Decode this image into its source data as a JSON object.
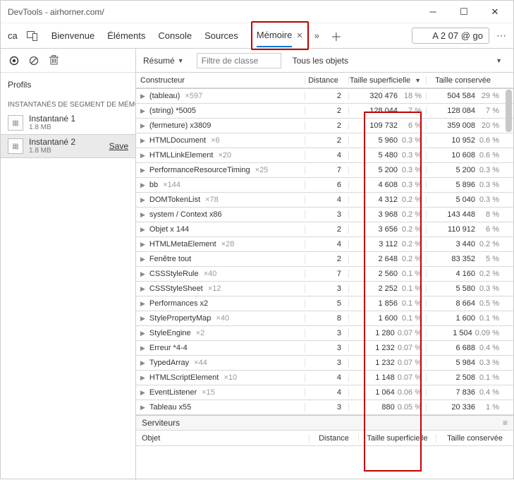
{
  "window": {
    "title": "DevTools - airhorner.com/"
  },
  "topstrip": {
    "prefix": "ca",
    "tabs": {
      "welcome": "Bienvenue",
      "elements": "Éléments",
      "console": "Console",
      "sources": "Sources",
      "memory": "Mémoire"
    },
    "url_box": "A 2 07 @ go"
  },
  "sidebar": {
    "profils": "Profils",
    "section": "INSTANTANÉS DE SEGMENT DE MÉMOIRE",
    "snapshots": [
      {
        "name": "Instantané 1",
        "size": "1.8 MB"
      },
      {
        "name": "Instantané 2",
        "size": "1.8 MB",
        "save": "Save"
      }
    ]
  },
  "filterbar": {
    "summary": "Résumé",
    "filter_placeholder": "Filtre de classe",
    "all_objects": "Tous les objets"
  },
  "headers": {
    "constructor": "Constructeur",
    "distance": "Distance",
    "shallow": "Taille superficielle",
    "retained": "Taille conservée"
  },
  "retainers": {
    "title": "Serviteurs",
    "object": "Objet",
    "distance": "Distance",
    "shallow": "Taille superficielle",
    "retained": "Taille conservée"
  },
  "rows": [
    {
      "name": "(tableau)",
      "suffix": "×597",
      "dist": "2",
      "s_val": "320 476",
      "s_pct": "18 %",
      "r_val": "504 584",
      "r_pct": "29 %"
    },
    {
      "name": "(string) *5005",
      "suffix": "",
      "dist": "2",
      "s_val": "128 044",
      "s_pct": "7 %",
      "r_val": "128 084",
      "r_pct": "7 %"
    },
    {
      "name": "(fermeture) x3809",
      "suffix": "",
      "dist": "2",
      "s_val": "109 732",
      "s_pct": "6 %",
      "r_val": "359 008",
      "r_pct": "20 %"
    },
    {
      "name": "HTMLDocument",
      "suffix": "×6",
      "dist": "2",
      "s_val": "5 960",
      "s_pct": "0.3 %",
      "r_val": "10 952",
      "r_pct": "0.6 %"
    },
    {
      "name": "HTMLLinkElement",
      "suffix": "×20",
      "dist": "4",
      "s_val": "5 480",
      "s_pct": "0.3 %",
      "r_val": "10 608",
      "r_pct": "0.6 %"
    },
    {
      "name": "PerformanceResourceTiming",
      "suffix": "×25",
      "dist": "7",
      "s_val": "5 200",
      "s_pct": "0.3 %",
      "r_val": "5 200",
      "r_pct": "0.3 %"
    },
    {
      "name": "bb",
      "suffix": "×144",
      "dist": "6",
      "s_val": "4 608",
      "s_pct": "0.3 %",
      "r_val": "5 896",
      "r_pct": "0.3 %"
    },
    {
      "name": "DOMTokenList",
      "suffix": "×78",
      "dist": "4",
      "s_val": "4 312",
      "s_pct": "0.2 %",
      "r_val": "5 040",
      "r_pct": "0.3 %"
    },
    {
      "name": "system / Context x86",
      "suffix": "",
      "dist": "3",
      "s_val": "3 968",
      "s_pct": "0.2 %",
      "r_val": "143 448",
      "r_pct": "8 %"
    },
    {
      "name": "Objet x 144",
      "suffix": "",
      "dist": "2",
      "s_val": "3 656",
      "s_pct": "0.2 %",
      "r_val": "110 912",
      "r_pct": "6 %"
    },
    {
      "name": "HTMLMetaElement",
      "suffix": "×28",
      "dist": "4",
      "s_val": "3 112",
      "s_pct": "0.2 %",
      "r_val": "3 440",
      "r_pct": "0.2 %"
    },
    {
      "name": "Fenêtre tout",
      "suffix": "",
      "dist": "2",
      "s_val": "2 648",
      "s_pct": "0.2 %",
      "r_val": "83 352",
      "r_pct": "5 %"
    },
    {
      "name": "CSSStyleRule",
      "suffix": "×40",
      "dist": "7",
      "s_val": "2 560",
      "s_pct": "0.1 %",
      "r_val": "4 160",
      "r_pct": "0.2 %"
    },
    {
      "name": "CSSStyleSheet",
      "suffix": "×12",
      "dist": "3",
      "s_val": "2 252",
      "s_pct": "0.1 %",
      "r_val": "5 580",
      "r_pct": "0.3 %"
    },
    {
      "name": "Performances x2",
      "suffix": "",
      "dist": "5",
      "s_val": "1 856",
      "s_pct": "0.1 %",
      "r_val": "8 664",
      "r_pct": "0.5 %"
    },
    {
      "name": "StylePropertyMap",
      "suffix": "×40",
      "dist": "8",
      "s_val": "1 600",
      "s_pct": "0.1 %",
      "r_val": "1 600",
      "r_pct": "0.1 %"
    },
    {
      "name": "StyleEngine",
      "suffix": "×2",
      "dist": "3",
      "s_val": "1 280",
      "s_pct": "0.07 %",
      "r_val": "1 504",
      "r_pct": "0.09 %"
    },
    {
      "name": "Erreur *4-4",
      "suffix": "",
      "dist": "3",
      "s_val": "1 232",
      "s_pct": "0.07 %",
      "r_val": "6 688",
      "r_pct": "0.4 %"
    },
    {
      "name": "TypedArray",
      "suffix": "×44",
      "dist": "3",
      "s_val": "1 232",
      "s_pct": "0.07 %",
      "r_val": "5 984",
      "r_pct": "0.3 %"
    },
    {
      "name": "HTMLScriptElement",
      "suffix": "×10",
      "dist": "4",
      "s_val": "1 148",
      "s_pct": "0.07 %",
      "r_val": "2 508",
      "r_pct": "0.1 %"
    },
    {
      "name": "EventListener",
      "suffix": "×15",
      "dist": "4",
      "s_val": "1 064",
      "s_pct": "0.06 %",
      "r_val": "7 836",
      "r_pct": "0.4 %"
    },
    {
      "name": "Tableau x55",
      "suffix": "",
      "dist": "3",
      "s_val": "880",
      "s_pct": "0.05 %",
      "r_val": "20 336",
      "r_pct": "1 %"
    }
  ]
}
